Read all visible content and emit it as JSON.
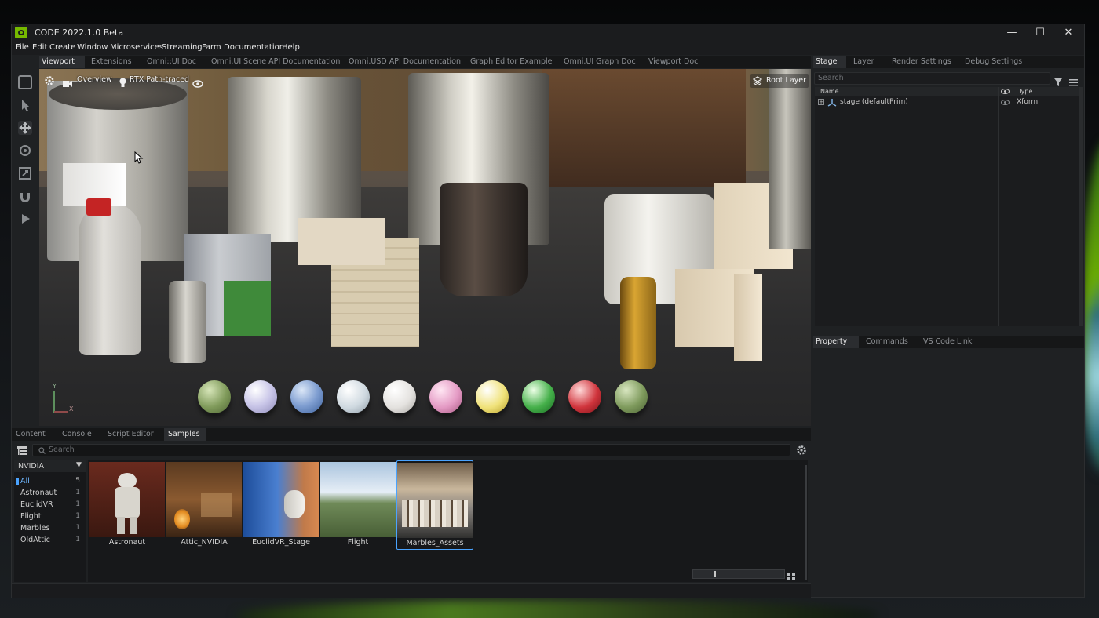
{
  "app": {
    "title": "CODE 2022.1.0 Beta",
    "window_controls": {
      "minimize": "—",
      "maximize": "☐",
      "close": "✕"
    }
  },
  "menu": [
    "File",
    "Edit",
    "Create",
    "Window",
    "Microservices",
    "Streaming",
    "Farm",
    "Documentation",
    "Help"
  ],
  "main_tabs": [
    "Viewport",
    "Extensions",
    "Omni::UI Doc",
    "Omni.UI Scene API Documentation",
    "Omni.USD API Documentation",
    "Graph Editor Example",
    "Omni.UI Graph Doc",
    "Viewport Doc"
  ],
  "main_tabs_active": "Viewport",
  "viewport": {
    "camera_label": "Overview",
    "renderer_label": "RTX Path-traced",
    "layer_label": "Root Layer",
    "axis_y": "Y",
    "axis_x": "X"
  },
  "left_tools": [
    "select-mode-icon",
    "pointer-icon",
    "move-icon",
    "rotate-icon",
    "scale-icon",
    "snap-icon",
    "play-icon"
  ],
  "bottom_tabs": [
    "Content",
    "Console",
    "Script Editor",
    "Samples"
  ],
  "bottom_tabs_active": "Samples",
  "samples": {
    "search_placeholder": "Search",
    "library": "NVIDIA",
    "categories": [
      {
        "name": "All",
        "count": "5"
      },
      {
        "name": "Astronaut",
        "count": "1"
      },
      {
        "name": "EuclidVR",
        "count": "1"
      },
      {
        "name": "Flight",
        "count": "1"
      },
      {
        "name": "Marbles",
        "count": "1"
      },
      {
        "name": "OldAttic",
        "count": "1"
      }
    ],
    "items": [
      {
        "label": "Astronaut"
      },
      {
        "label": "Attic_NVIDIA"
      },
      {
        "label": "EuclidVR_Stage"
      },
      {
        "label": "Flight"
      },
      {
        "label": "Marbles_Assets"
      }
    ],
    "selected_item": "Marbles_Assets"
  },
  "stage": {
    "tabs": [
      "Stage",
      "Layer",
      "Render Settings",
      "Debug Settings"
    ],
    "active_tab": "Stage",
    "search_placeholder": "Search",
    "columns": {
      "name": "Name",
      "type": "Type"
    },
    "rows": [
      {
        "name": "stage (defaultPrim)",
        "type": "Xform"
      }
    ]
  },
  "property": {
    "tabs": [
      "Property",
      "Commands",
      "VS Code Link"
    ],
    "active_tab": "Property"
  },
  "colors": {
    "accent": "#76b900",
    "selection": "#4aa3ff"
  }
}
